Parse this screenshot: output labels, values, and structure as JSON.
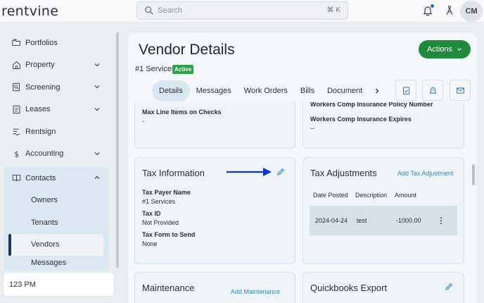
{
  "app": {
    "logo": "rentvine"
  },
  "search": {
    "placeholder": "Search",
    "shortcut": "⌘ K"
  },
  "user": {
    "initials": "CM"
  },
  "sidebar": {
    "items": [
      {
        "label": "Portfolios",
        "icon": "folders-icon"
      },
      {
        "label": "Property",
        "icon": "house-icon",
        "expandable": true
      },
      {
        "label": "Screening",
        "icon": "screening-icon",
        "expandable": true
      },
      {
        "label": "Leases",
        "icon": "document-icon",
        "expandable": true
      },
      {
        "label": "Rentsign",
        "icon": "signature-icon"
      },
      {
        "label": "Accounting",
        "icon": "dollar-icon",
        "expandable": true
      }
    ],
    "contacts": {
      "label": "Contacts",
      "icon": "book-icon",
      "sub_items": [
        "Owners",
        "Tenants",
        "Vendors",
        "Messages"
      ],
      "active": "Vendors"
    },
    "footer_text": "123 PM"
  },
  "page": {
    "title": "Vendor Details",
    "vendor_name": "#1 Services",
    "status": "Active",
    "actions_label": "Actions"
  },
  "tabs": [
    "Details",
    "Messages",
    "Work Orders",
    "Bills",
    "Document"
  ],
  "active_tab": "Details",
  "cards": {
    "top_left": {
      "label": "Max Line Items on Checks",
      "value": "-"
    },
    "top_right": {
      "label_cut": "Workers Comp Insurance Policy Number",
      "label": "Workers Comp Insurance Expires",
      "value": "--"
    },
    "tax_info": {
      "title": "Tax Information",
      "fields": [
        {
          "label": "Tax Payer Name",
          "value": "#1 Services"
        },
        {
          "label": "Tax ID",
          "value": "Not Provided"
        },
        {
          "label": "Tax Form to Send",
          "value": "None"
        }
      ]
    },
    "tax_adjustments": {
      "title": "Tax Adjustments",
      "add_label": "Add Tax Adjustment",
      "columns": [
        "Date Posted",
        "Description",
        "Amount"
      ],
      "rows": [
        {
          "date": "2024-04-24",
          "description": "test",
          "amount": "-1000.00"
        }
      ]
    },
    "maintenance": {
      "title": "Maintenance",
      "add_label": "Add Maintenance"
    },
    "quickbooks": {
      "title": "Quickbooks Export"
    }
  },
  "colors": {
    "accent": "#1f8a3b",
    "annotation_arrow": "#1433d6",
    "link": "#3a86b8",
    "active_nav": "#1b3b5b"
  }
}
